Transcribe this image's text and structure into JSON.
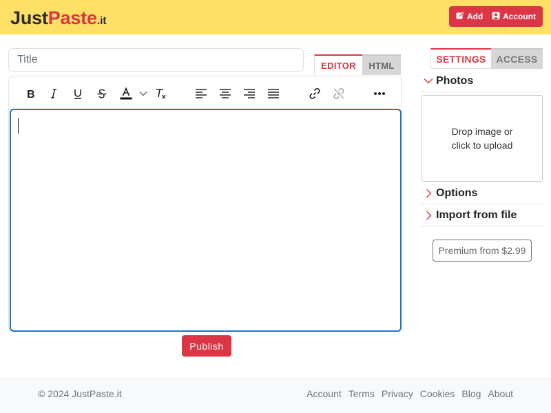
{
  "header": {
    "logo": {
      "part1": "Just",
      "part2": "Paste",
      "part3": ".it"
    },
    "add_label": "Add",
    "account_label": "Account",
    "bg_color": "#ffe066",
    "accent_color": "#dc3545"
  },
  "editor": {
    "title_placeholder": "Title",
    "tabs": [
      {
        "label": "EDITOR",
        "active": true
      },
      {
        "label": "HTML",
        "active": false
      }
    ],
    "toolbar": [
      {
        "icon": "bold-icon"
      },
      {
        "icon": "italic-icon"
      },
      {
        "icon": "underline-icon"
      },
      {
        "icon": "strikethrough-icon"
      },
      {
        "icon": "text-color-icon"
      },
      {
        "icon": "chevron-down-icon"
      },
      {
        "icon": "clear-formatting-icon"
      },
      {
        "icon": "align-left-icon"
      },
      {
        "icon": "align-center-icon"
      },
      {
        "icon": "align-right-icon"
      },
      {
        "icon": "align-justify-icon"
      },
      {
        "icon": "link-icon"
      },
      {
        "icon": "unlink-icon"
      },
      {
        "icon": "more-icon"
      }
    ],
    "content": "",
    "publish_label": "Publish",
    "focus_color": "#1a73c9"
  },
  "sidebar": {
    "tabs": [
      {
        "label": "SETTINGS",
        "active": true
      },
      {
        "label": "ACCESS",
        "active": false
      }
    ],
    "sections": [
      {
        "label": "Photos",
        "expanded": true
      },
      {
        "label": "Options",
        "expanded": false
      },
      {
        "label": "Import from file",
        "expanded": false
      }
    ],
    "dropzone_line1": "Drop image or",
    "dropzone_line2": "click to upload",
    "premium_label": "Premium from $2.99"
  },
  "footer": {
    "copyright": "© 2024 JustPaste.it",
    "links": [
      "Account",
      "Terms",
      "Privacy",
      "Cookies",
      "Blog",
      "About"
    ]
  }
}
